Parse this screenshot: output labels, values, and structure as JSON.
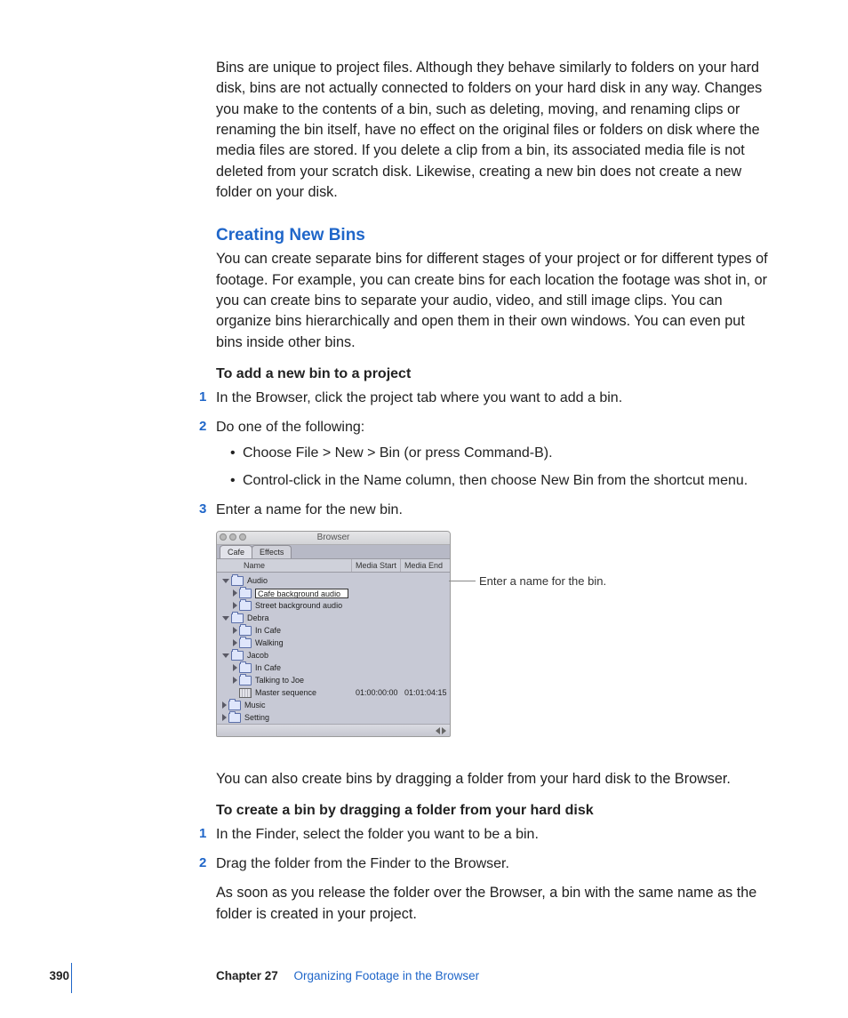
{
  "intro_para": "Bins are unique to project files. Although they behave similarly to folders on your hard disk, bins are not actually connected to folders on your hard disk in any way. Changes you make to the contents of a bin, such as deleting, moving, and renaming clips or renaming the bin itself, have no effect on the original files or folders on disk where the media files are stored. If you delete a clip from a bin, its associated media file is not deleted from your scratch disk. Likewise, creating a new bin does not create a new folder on your disk.",
  "section_heading": "Creating New Bins",
  "section_para": "You can create separate bins for different stages of your project or for different types of footage. For example, you can create bins for each location the footage was shot in, or you can create bins to separate your audio, video, and still image clips. You can organize bins hierarchically and open them in their own windows. You can even put bins inside other bins.",
  "task1_head": "To add a new bin to a project",
  "task1_steps": {
    "s1": "In the Browser, click the project tab where you want to add a bin.",
    "s2": "Do one of the following:",
    "s2_b1": "Choose File > New > Bin (or press Command-B).",
    "s2_b2": "Control-click in the Name column, then choose New Bin from the shortcut menu.",
    "s3": "Enter a name for the new bin."
  },
  "browser": {
    "title": "Browser",
    "tabs": {
      "t1": "Cafe",
      "t2": "Effects"
    },
    "cols": {
      "name": "Name",
      "ms": "Media Start",
      "me": "Media End"
    },
    "rows": {
      "audio": "Audio",
      "cafe_bg": "Cafe background audio",
      "street_bg": "Street background audio",
      "debra": "Debra",
      "in_cafe1": "In Cafe",
      "walking": "Walking",
      "jacob": "Jacob",
      "in_cafe2": "In Cafe",
      "talking": "Talking to Joe",
      "master": "Master sequence",
      "master_ms": "01:00:00:00",
      "master_me": "01:01:04:15",
      "music": "Music",
      "setting": "Setting"
    }
  },
  "callout": "Enter a name for the bin.",
  "after_shot": "You can also create bins by dragging a folder from your hard disk to the Browser.",
  "task2_head": "To create a bin by dragging a folder from your hard disk",
  "task2_steps": {
    "s1": "In the Finder, select the folder you want to be a bin.",
    "s2": "Drag the folder from the Finder to the Browser."
  },
  "closing": "As soon as you release the folder over the Browser, a bin with the same name as the folder is created in your project.",
  "footer": {
    "page": "390",
    "chapter": "Chapter 27",
    "title": "Organizing Footage in the Browser"
  }
}
